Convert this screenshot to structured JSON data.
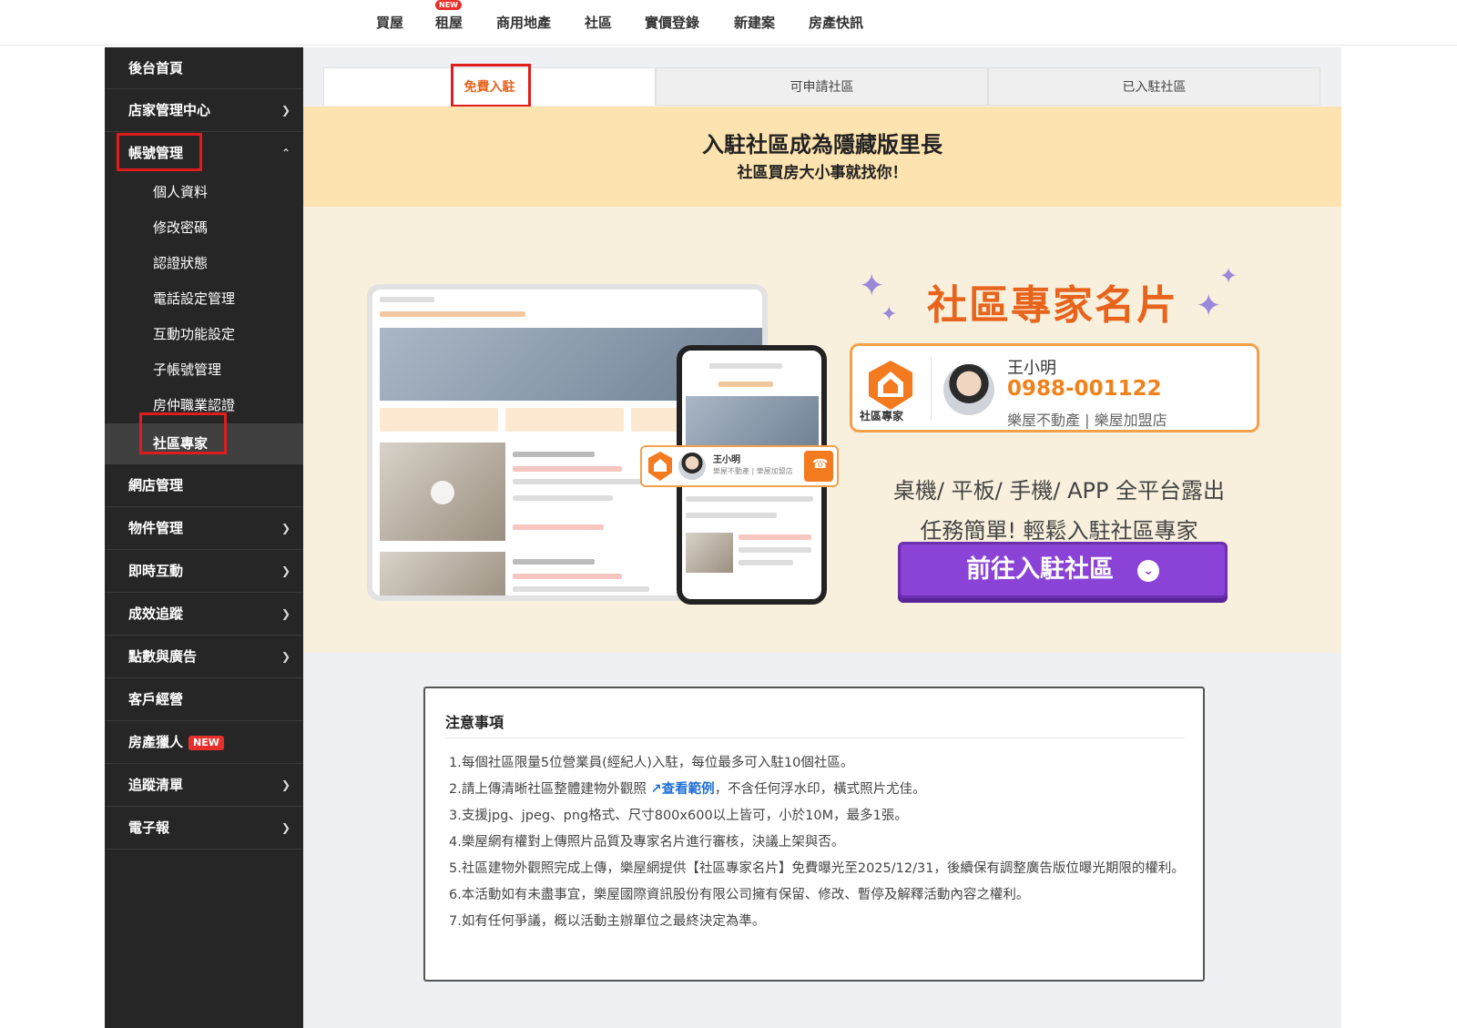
{
  "topnav": {
    "items": [
      "買屋",
      "租屋",
      "商用地產",
      "社區",
      "實價登錄",
      "新建案",
      "房產快訊"
    ],
    "new_badge": "NEW"
  },
  "sidebar": {
    "home": "後台首頁",
    "store_center": "店家管理中心",
    "account_mgmt": "帳號管理",
    "sub_items": [
      "個人資料",
      "修改密碼",
      "認證狀態",
      "電話設定管理",
      "互動功能設定",
      "子帳號管理",
      "房仲職業認證",
      "社區專家"
    ],
    "active_sub": "社區專家",
    "items_after": [
      {
        "label": "網店管理",
        "chevron": false
      },
      {
        "label": "物件管理",
        "chevron": true
      },
      {
        "label": "即時互動",
        "chevron": true
      },
      {
        "label": "成效追蹤",
        "chevron": true
      },
      {
        "label": "點數與廣告",
        "chevron": true
      },
      {
        "label": "客戶經營",
        "chevron": false
      },
      {
        "label": "房產獵人",
        "chevron": false,
        "badge": "NEW"
      },
      {
        "label": "追蹤清單",
        "chevron": true
      },
      {
        "label": "電子報",
        "chevron": true
      }
    ]
  },
  "tabs": [
    "免費入駐",
    "可申請社區",
    "已入駐社區"
  ],
  "active_tab": "免費入駐",
  "banner": {
    "headline": "入駐社區成為隱藏版里長",
    "subline": "社區買房大小事就找你！",
    "expert_title": "社區專家名片",
    "card": {
      "badge_label": "社區專家",
      "name": "王小明",
      "phone": "0988-001122",
      "company": "樂屋不動產 | 樂屋加盟店"
    },
    "popup": {
      "name": "王小明",
      "company": "樂屋不動產 | 樂屋加盟店"
    },
    "platform_line1": "桌機/ 平板/ 手機/ APP 全平台露出",
    "platform_line2": "任務簡單! 輕鬆入駐社區專家",
    "cta_label": "前往入駐社區",
    "cta_icon": "chevron-circle-down-icon"
  },
  "notice": {
    "title": "注意事項",
    "items": [
      {
        "num": "1.",
        "text": "每個社區限量5位營業員(經紀人)入駐，每位最多可入駐10個社區。"
      },
      {
        "num": "2.",
        "text_before": "請上傳清晰社區整體建物外觀照 ",
        "link": "查看範例",
        "text_after": "，不含任何浮水印，橫式照片尤佳。"
      },
      {
        "num": "3.",
        "text": "支援jpg、jpeg、png格式、尺寸800x600以上皆可，小於10M，最多1張。"
      },
      {
        "num": "4.",
        "text": "樂屋網有權對上傳照片品質及專家名片進行審核，決議上架與否。"
      },
      {
        "num": "5.",
        "text": "社區建物外觀照完成上傳，樂屋網提供【社區專家名片】免費曝光至2025/12/31，後續保有調整廣告版位曝光期限的權利。"
      },
      {
        "num": "6.",
        "text": "本活動如有未盡事宜，樂屋國際資訊股份有限公司擁有保留、修改、暫停及解釋活動內容之權利。"
      },
      {
        "num": "7.",
        "text": "如有任何爭議，概以活動主辦單位之最終決定為準。"
      }
    ]
  },
  "colors": {
    "sidebar_bg": "#262626",
    "accent_orange": "#e8641c",
    "cta_purple": "#8a43d6",
    "highlight_red": "#e01d1d"
  }
}
